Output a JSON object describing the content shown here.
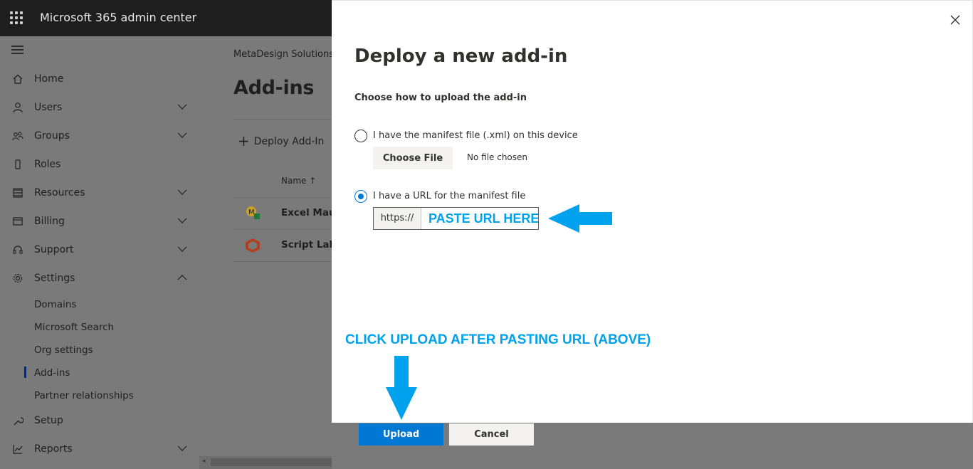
{
  "app": {
    "title": "Microsoft 365 admin center"
  },
  "nav": {
    "items": [
      {
        "label": "Home",
        "icon": "home-icon",
        "expandable": false
      },
      {
        "label": "Users",
        "icon": "user-icon",
        "expandable": true
      },
      {
        "label": "Groups",
        "icon": "groups-icon",
        "expandable": true
      },
      {
        "label": "Roles",
        "icon": "roles-icon",
        "expandable": false
      },
      {
        "label": "Resources",
        "icon": "resources-icon",
        "expandable": true
      },
      {
        "label": "Billing",
        "icon": "billing-icon",
        "expandable": true
      },
      {
        "label": "Support",
        "icon": "support-icon",
        "expandable": true
      },
      {
        "label": "Settings",
        "icon": "gear-icon",
        "expandable": true,
        "expanded": true
      },
      {
        "label": "Setup",
        "icon": "wrench-icon",
        "expandable": false
      },
      {
        "label": "Reports",
        "icon": "chart-icon",
        "expandable": true
      }
    ],
    "settings_sub": [
      "Domains",
      "Microsoft Search",
      "Org settings",
      "Add-ins",
      "Partner relationships"
    ],
    "selected_sub": "Add-ins"
  },
  "main": {
    "tenant": "MetaDesign Solutions",
    "title": "Add-ins",
    "deploy_label": "Deploy Add-In",
    "column_name": "Name ↑",
    "rows": [
      {
        "name": "Excel Mauti"
      },
      {
        "name": "Script Lab,"
      }
    ]
  },
  "dialog": {
    "title": "Deploy a new add-in",
    "subtitle": "Choose how to upload the add-in",
    "option_file": "I have the manifest file (.xml) on this device",
    "choose_file": "Choose File",
    "no_file": "No file chosen",
    "option_url": "I have a URL for the manifest file",
    "selected_option": "url",
    "url_prefix": "https://",
    "url_placeholder": "PASTE URL HERE",
    "upload": "Upload",
    "cancel": "Cancel"
  },
  "annotations": {
    "upload_hint": "CLICK UPLOAD AFTER PASTING URL (ABOVE)",
    "color": "#00a2ed"
  },
  "colors": {
    "accent": "#0078d4",
    "annotation": "#00a2ed",
    "topbar": "#1e1e1e"
  }
}
